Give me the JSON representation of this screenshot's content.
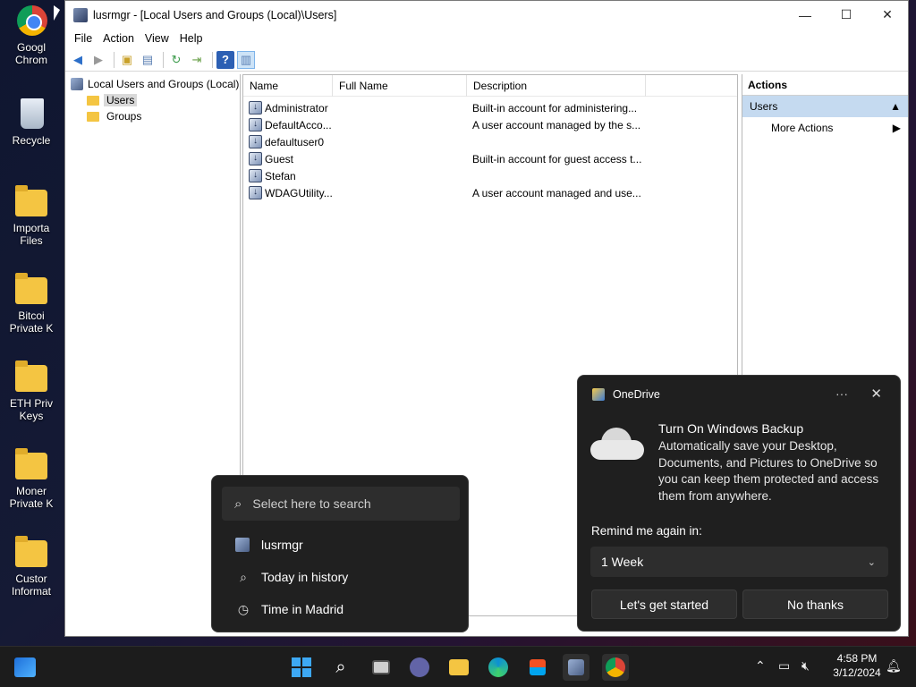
{
  "desktop": {
    "icons": [
      {
        "name": "chrome",
        "label": "Googl\nChrom"
      },
      {
        "name": "recycle",
        "label": "Recycle"
      },
      {
        "name": "important",
        "label": "Importa\nFiles"
      },
      {
        "name": "bitcoin",
        "label": "Bitcoi\nPrivate K"
      },
      {
        "name": "eth",
        "label": "ETH Priv\nKeys"
      },
      {
        "name": "monero",
        "label": "Moner\nPrivate K"
      },
      {
        "name": "custom",
        "label": "Custor\nInformat"
      }
    ]
  },
  "window": {
    "title": "lusrmgr - [Local Users and Groups (Local)\\Users]",
    "controls": {
      "minimize": "—",
      "maximize": "☐",
      "close": "✕"
    },
    "menu": [
      "File",
      "Action",
      "View",
      "Help"
    ],
    "tree": {
      "root": "Local Users and Groups (Local)",
      "items": [
        "Users",
        "Groups"
      ]
    },
    "list": {
      "columns": [
        "Name",
        "Full Name",
        "Description"
      ],
      "rows": [
        {
          "name": "Administrator",
          "full_name": "",
          "description": "Built-in account for administering..."
        },
        {
          "name": "DefaultAcco...",
          "full_name": "",
          "description": "A user account managed by the s..."
        },
        {
          "name": "defaultuser0",
          "full_name": "",
          "description": ""
        },
        {
          "name": "Guest",
          "full_name": "",
          "description": "Built-in account for guest access t..."
        },
        {
          "name": "Stefan",
          "full_name": "",
          "description": ""
        },
        {
          "name": "WDAGUtility...",
          "full_name": "",
          "description": "A user account managed and use..."
        }
      ]
    },
    "actions": {
      "header": "Actions",
      "section": "Users",
      "more": "More Actions"
    }
  },
  "search_popup": {
    "placeholder": "Select here to search",
    "results": [
      {
        "icon": "lusrmgr-icon",
        "label": "lusrmgr"
      },
      {
        "icon": "search-icon",
        "label": "Today in history"
      },
      {
        "icon": "clock-icon",
        "label": "Time in Madrid"
      }
    ]
  },
  "toast": {
    "app": "OneDrive",
    "more": "···",
    "close": "✕",
    "title": "Turn On Windows Backup",
    "body": "Automatically save your Desktop, Documents, and Pictures to OneDrive so you can keep them protected and access them from anywhere.",
    "remind_label": "Remind me again in:",
    "remind_value": "1 Week",
    "primary_button": "Let's get started",
    "secondary_button": "No thanks"
  },
  "taskbar": {
    "time": "4:58 PM",
    "date": "3/12/2024"
  },
  "colors": {
    "accent": "#3da8f4",
    "selection": "#c5daf0",
    "toast_bg": "#1f1f1f"
  }
}
